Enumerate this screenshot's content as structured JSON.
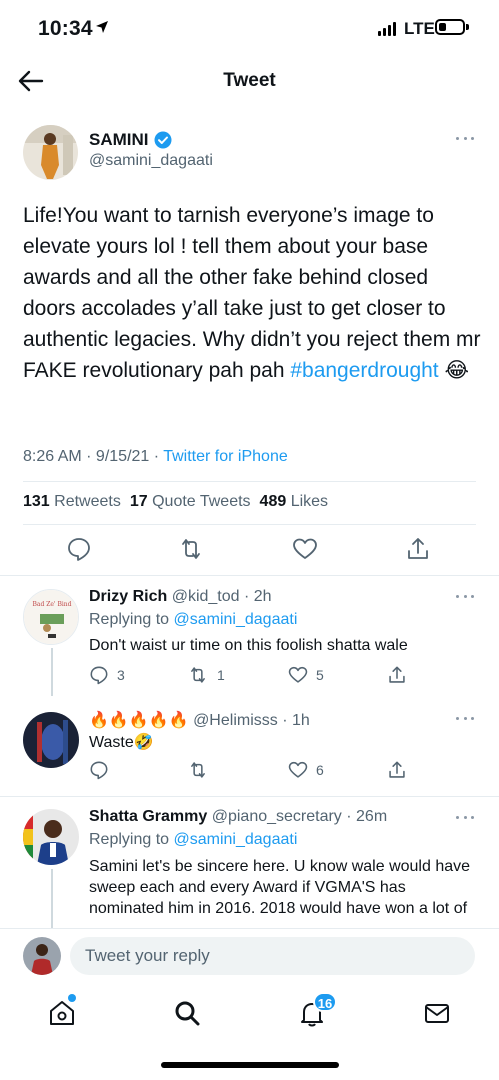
{
  "status_bar": {
    "time": "10:34",
    "network": "LTE"
  },
  "header": {
    "title": "Tweet"
  },
  "tweet": {
    "author_name": "SAMINI",
    "author_handle": "@samini_dagaati",
    "text": "Life!You want to tarnish everyone’s image to elevate yours lol ! tell them about your base awards and all the other fake behind closed doors accolades y’all take just to get closer to authentic legacies. Why didn’t you reject them mr FAKE revolutionary pah pah ",
    "hashtag": "#bangerdrought",
    "emoji": "😂",
    "timestamp": "8:26 AM · 9/15/21 · ",
    "source": "Twitter for iPhone",
    "retweets": "131",
    "retweets_label": "Retweets",
    "quotes": "17",
    "quotes_label": "Quote Tweets",
    "likes": "489",
    "likes_label": "Likes"
  },
  "replies": [
    {
      "name": "Drizy Rich",
      "handle_time": "@kid_tod · 2h",
      "replying_prefix": "Replying to ",
      "replying_to": "@samini_dagaati",
      "text": "Don't waist ur time on this foolish shatta wale",
      "reply_count": "3",
      "retweet_count": "1",
      "like_count": "5"
    },
    {
      "name": "🔥🔥🔥🔥🔥",
      "handle_time": "@Helimisss · 1h",
      "text": "Waste🤣",
      "reply_count": "",
      "retweet_count": "",
      "like_count": "6"
    },
    {
      "name": "Shatta Grammy",
      "handle_time": "@piano_secretary · 26m",
      "replying_prefix": "Replying to ",
      "replying_to": "@samini_dagaati",
      "text": "Samini let's be sincere here. U know wale would have sweep each and every Award if VGMA'S has nominated him in 2016. 2018 would have won a lot of"
    }
  ],
  "compose": {
    "placeholder": "Tweet your reply"
  },
  "tabbar": {
    "notifications_badge": "16"
  },
  "colors": {
    "accent": "#1d9bf0",
    "secondary_text": "#536471",
    "primary_text": "#0f1419"
  }
}
